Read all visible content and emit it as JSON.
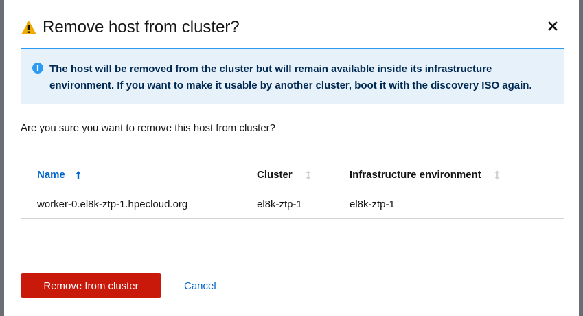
{
  "modal": {
    "title": "Remove host from cluster?",
    "title_icon": "warning-triangle-icon",
    "close_icon": "close-icon"
  },
  "alert": {
    "icon": "info-circle-icon",
    "text": "The host will be removed from the cluster but will remain available inside its infrastructure environment. If you want to make it usable by another cluster, boot it with the discovery ISO again."
  },
  "question": "Are you sure you want to remove this host from cluster?",
  "table": {
    "columns": [
      {
        "label": "Name",
        "sort": "ascending"
      },
      {
        "label": "Cluster",
        "sort": "none"
      },
      {
        "label": "Infrastructure environment",
        "sort": "none"
      }
    ],
    "rows": [
      [
        "worker-0.el8k-ztp-1.hpecloud.org",
        "el8k-ztp-1",
        "el8k-ztp-1"
      ]
    ]
  },
  "actions": {
    "confirm_label": "Remove from cluster",
    "cancel_label": "Cancel"
  },
  "colors": {
    "danger": "#c9190b",
    "link": "#0066cc",
    "info_bg": "#e7f1fa",
    "warning": "#f0ab00"
  }
}
